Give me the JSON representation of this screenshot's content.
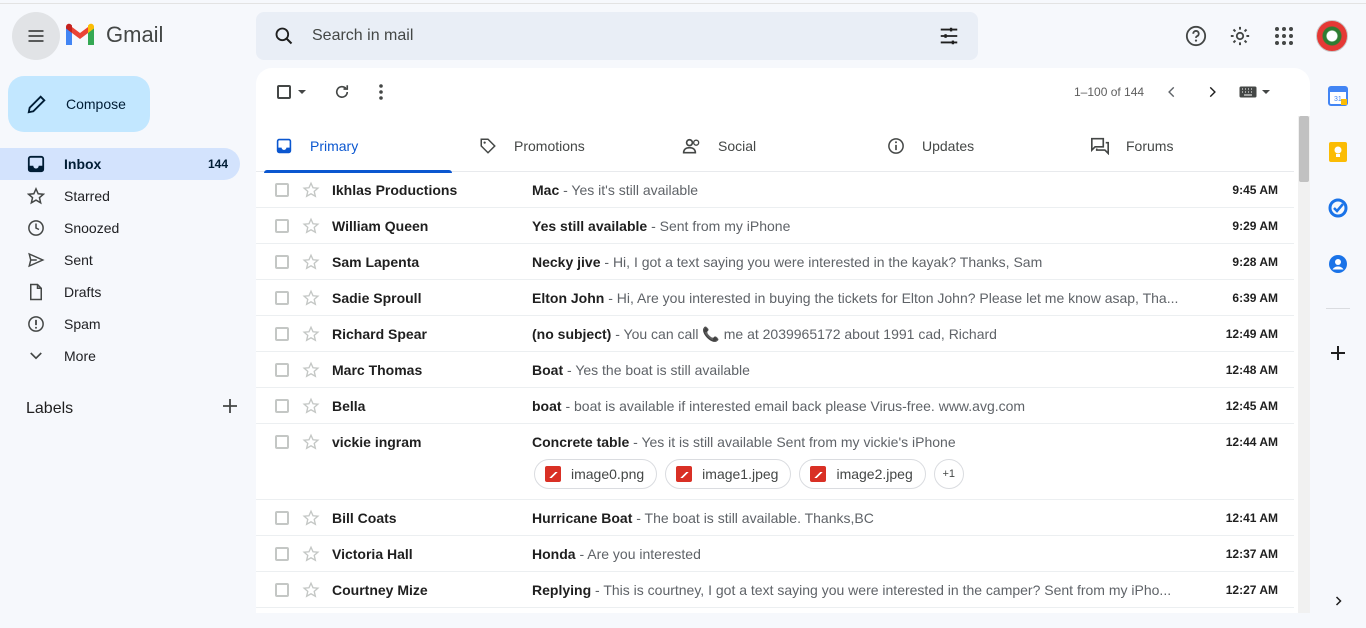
{
  "app": {
    "name": "Gmail"
  },
  "search": {
    "placeholder": "Search in mail"
  },
  "compose": {
    "label": "Compose"
  },
  "nav": {
    "items": [
      {
        "label": "Inbox",
        "count": "144",
        "icon": "inbox-icon"
      },
      {
        "label": "Starred",
        "count": "",
        "icon": "star-icon"
      },
      {
        "label": "Snoozed",
        "count": "",
        "icon": "clock-icon"
      },
      {
        "label": "Sent",
        "count": "",
        "icon": "send-icon"
      },
      {
        "label": "Drafts",
        "count": "",
        "icon": "file-icon"
      },
      {
        "label": "Spam",
        "count": "",
        "icon": "report-icon"
      },
      {
        "label": "More",
        "count": "",
        "icon": "chevron-down-icon"
      }
    ],
    "labels_heading": "Labels"
  },
  "toolbar": {
    "pager": "1–100 of 144"
  },
  "tabs": [
    {
      "label": "Primary",
      "icon": "inbox-icon"
    },
    {
      "label": "Promotions",
      "icon": "tag-icon"
    },
    {
      "label": "Social",
      "icon": "people-icon"
    },
    {
      "label": "Updates",
      "icon": "info-icon"
    },
    {
      "label": "Forums",
      "icon": "forum-icon"
    }
  ],
  "emails": [
    {
      "sender": "Ikhlas Productions",
      "subject": "Mac",
      "snippet": " - Yes it's still available",
      "time": "9:45 AM"
    },
    {
      "sender": "William Queen",
      "subject": "Yes still available",
      "snippet": " - Sent from my iPhone",
      "time": "9:29 AM"
    },
    {
      "sender": "Sam Lapenta",
      "subject": "Necky jive",
      "snippet": " - Hi, I got a text saying you were interested in the kayak? Thanks, Sam",
      "time": "9:28 AM"
    },
    {
      "sender": "Sadie Sproull",
      "subject": "Elton John",
      "snippet": " - Hi, Are you interested in buying the tickets for Elton John? Please let me know asap, Tha...",
      "time": "6:39 AM"
    },
    {
      "sender": "Richard Spear",
      "subject": "(no subject)",
      "snippet": " - You can call 📞 me at 2039965172 about 1991 cad, Richard",
      "time": "12:49 AM"
    },
    {
      "sender": "Marc Thomas",
      "subject": "Boat",
      "snippet": " - Yes the boat is still available",
      "time": "12:48 AM"
    },
    {
      "sender": "Bella",
      "subject": "boat",
      "snippet": " - boat is available if interested email back please Virus-free. www.avg.com",
      "time": "12:45 AM"
    },
    {
      "sender": "vickie ingram",
      "subject": "Concrete table",
      "snippet": " - Yes it is still available Sent from my vickie's iPhone",
      "time": "12:44 AM",
      "attachments": [
        "image0.png",
        "image1.jpeg",
        "image2.jpeg"
      ],
      "more_attachments": "+1"
    },
    {
      "sender": "Bill Coats",
      "subject": "Hurricane Boat",
      "snippet": " - The boat is still available. Thanks,BC",
      "time": "12:41 AM"
    },
    {
      "sender": "Victoria Hall",
      "subject": "Honda",
      "snippet": " - Are you interested",
      "time": "12:37 AM"
    },
    {
      "sender": "Courtney Mize",
      "subject": "Replying",
      "snippet": " - This is courtney, I got a text saying you were interested in the camper? Sent from my iPho...",
      "time": "12:27 AM"
    }
  ],
  "colors": {
    "accent": "#0b57d0",
    "compose_bg": "#c2e7ff",
    "active_nav": "#d3e3fd",
    "search_bg": "#e9eef6",
    "attachment_icon": "#d93025"
  }
}
